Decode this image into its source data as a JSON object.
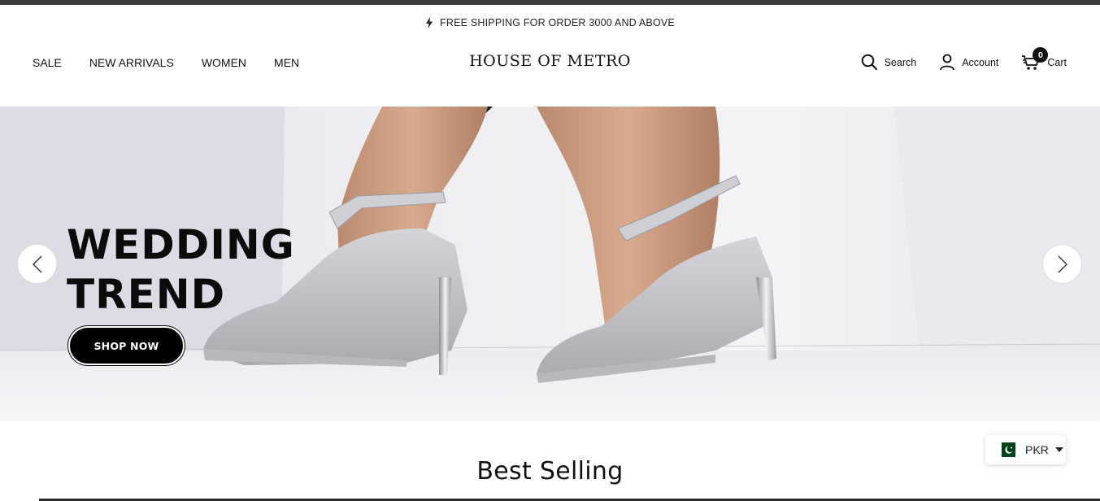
{
  "announcement": {
    "text": "FREE SHIPPING FOR ORDER 3000 AND ABOVE",
    "icon": "lightning-icon"
  },
  "nav": {
    "items": [
      {
        "label": "SALE"
      },
      {
        "label": "NEW ARRIVALS"
      },
      {
        "label": "WOMEN"
      },
      {
        "label": "MEN"
      }
    ]
  },
  "logo": {
    "text": "HOUSE OF METRO"
  },
  "actions": {
    "search_label": "Search",
    "account_label": "Account",
    "cart_label": "Cart",
    "cart_count": "0"
  },
  "hero": {
    "title_line1": "WEDDING",
    "title_line2": "TREND",
    "cta_label": "SHOP NOW",
    "prev_icon": "chevron-left-icon",
    "next_icon": "chevron-right-icon"
  },
  "section": {
    "title": "Best Selling"
  },
  "currency": {
    "code": "PKR",
    "flag": "pakistan-flag-icon"
  },
  "colors": {
    "accent": "#000000",
    "flag_green": "#01411c",
    "hero_bg": "#e4e4ea"
  }
}
